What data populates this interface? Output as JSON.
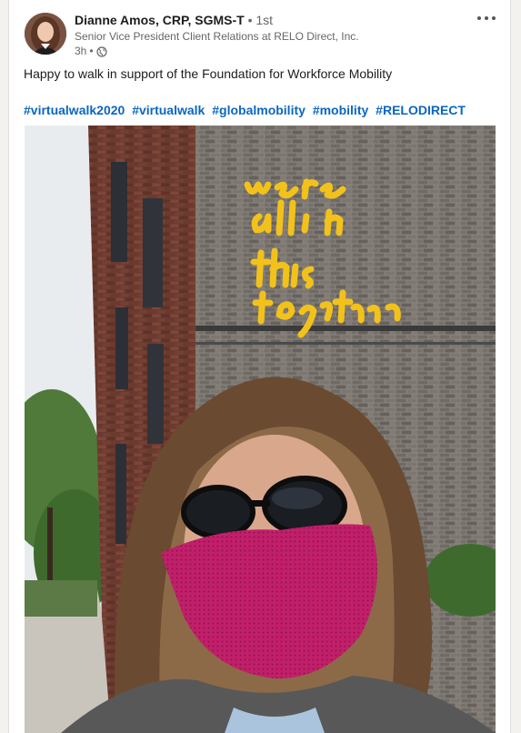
{
  "post": {
    "author": {
      "name": "Dianne Amos, CRP, SGMS-T",
      "bullet": "•",
      "degree": "1st",
      "headline": "Senior Vice President Client Relations at RELO Direct, Inc."
    },
    "time": "3h",
    "time_bullet": "•",
    "visibility_icon": "globe-icon",
    "more_icon": "more-options-icon",
    "text": "Happy to walk in support of the Foundation for Workforce Mobility",
    "hashtags": [
      "#virtualwalk2020",
      "#virtualwalk",
      "#globalmobility",
      "#mobility",
      "#RELODIRECT"
    ],
    "image": {
      "mural_text_lines": [
        "we're",
        "all in",
        "this",
        "together"
      ],
      "mural_color": "#f2c21b",
      "mask_color": "#cc1f6e"
    }
  },
  "colors": {
    "hashtag": "#0a66c2",
    "background": "#f3f2ef",
    "card": "#ffffff"
  }
}
